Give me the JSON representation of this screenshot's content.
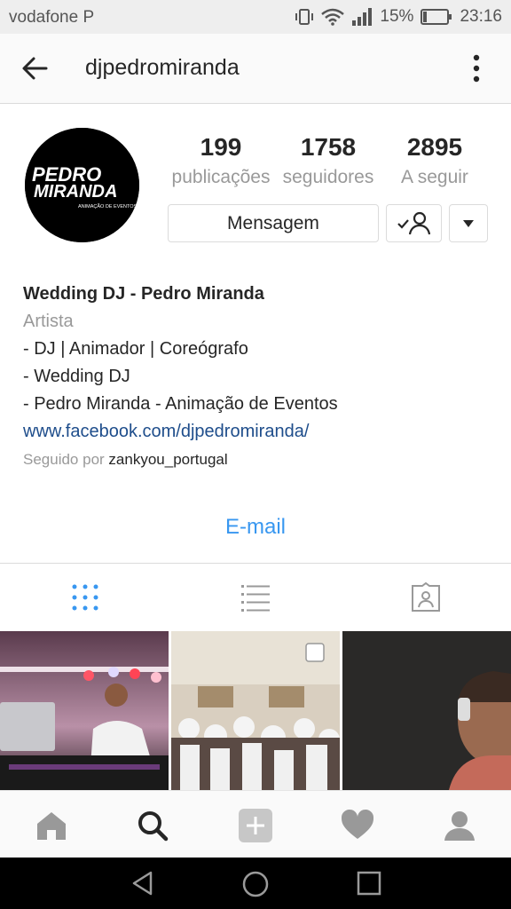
{
  "status_bar": {
    "carrier": "vodafone P",
    "battery": "15%",
    "time": "23:16"
  },
  "header": {
    "username": "djpedromiranda"
  },
  "avatar": {
    "line1": "PEDRO",
    "line2": "MIRANDA",
    "line3": "ANIMAÇÃO DE EVENTOS"
  },
  "stats": [
    {
      "count": "199",
      "label": "publicações"
    },
    {
      "count": "1758",
      "label": "seguidores"
    },
    {
      "count": "2895",
      "label": "A seguir"
    }
  ],
  "buttons": {
    "message": "Mensagem"
  },
  "bio": {
    "name": "Wedding DJ - Pedro Miranda",
    "category": "Artista",
    "lines": [
      "- DJ | Animador | Coreógrafo",
      "- Wedding DJ",
      "- Pedro Miranda - Animação de Eventos"
    ],
    "link": "www.facebook.com/djpedromiranda/",
    "followed_prefix": "Seguido por",
    "followed_user": "zankyou_portugal"
  },
  "contact": {
    "email": "E-mail"
  },
  "colors": {
    "accent_blue": "#3897f0",
    "link_blue": "#1e4d8b",
    "muted": "#999999"
  },
  "icons": {
    "tabs": [
      "grid-icon",
      "list-icon",
      "tagged-icon"
    ],
    "nav": [
      "home-icon",
      "search-icon",
      "add-icon",
      "heart-icon",
      "profile-icon"
    ]
  }
}
